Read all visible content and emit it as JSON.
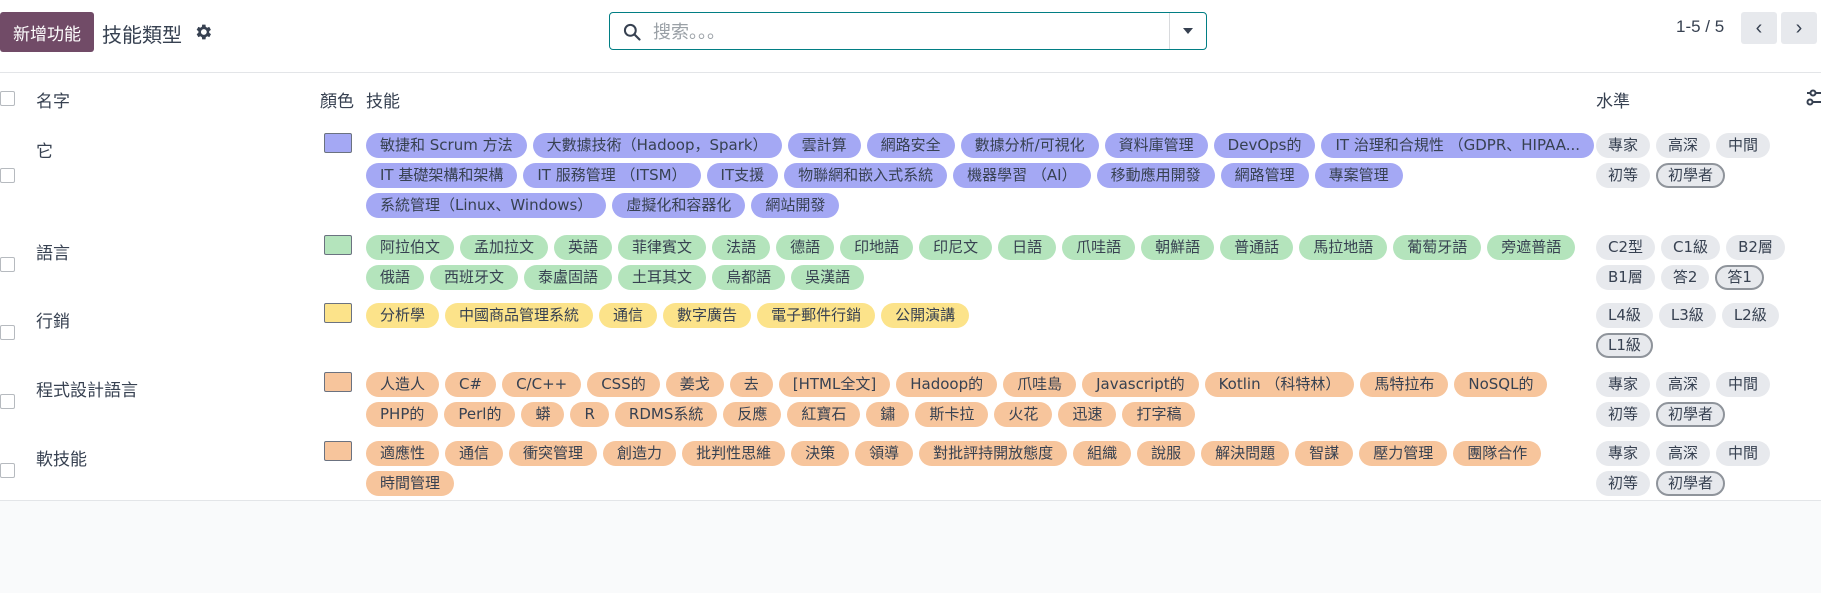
{
  "toolbar": {
    "new_label": "新增功能",
    "title": "技能類型",
    "settings_icon": "gear-icon"
  },
  "search": {
    "placeholder": "搜索。。。",
    "value": "",
    "icon": "search-icon",
    "dropdown_icon": "caret-down-icon"
  },
  "pager": {
    "value": "1-5 / 5",
    "prev_icon": "chevron-left-icon",
    "next_icon": "chevron-right-icon"
  },
  "list": {
    "headers": {
      "name": "名字",
      "color": "顏色",
      "skills": "技能",
      "levels": "水準"
    },
    "rows": [
      {
        "name": "它",
        "color": "#a4a8f4",
        "tag_color": "#a4a8f4",
        "skills": [
          "敏捷和 Scrum 方法",
          "大數據技術（Hadoop，Spark）",
          "雲計算",
          "網路安全",
          "數據分析/可視化",
          "資料庫管理",
          "DevOps的",
          "IT 治理和合規性 （GDPR、HIPAA...",
          "IT 基礎架構和架構",
          "IT 服務管理 （ITSM）",
          "IT支援",
          "物聯網和嵌入式系統",
          "機器學習 （AI）",
          "移動應用開發",
          "網路管理",
          "專案管理",
          "系統管理（Linux、Windows）",
          "虛擬化和容器化",
          "網站開發"
        ],
        "levels": [
          "專家",
          "高深",
          "中間",
          "初等",
          "初學者"
        ],
        "selected_level": "初學者"
      },
      {
        "name": "語言",
        "color": "#b4e4bc",
        "tag_color": "#b4e4bc",
        "skills": [
          "阿拉伯文",
          "孟加拉文",
          "英語",
          "菲律賓文",
          "法語",
          "德語",
          "印地語",
          "印尼文",
          "日語",
          "爪哇語",
          "朝鮮語",
          "普通話",
          "馬拉地語",
          "葡萄牙語",
          "旁遮普語",
          "俄語",
          "西班牙文",
          "泰盧固語",
          "土耳其文",
          "烏都語",
          "吳漢語"
        ],
        "levels": [
          "C2型",
          "C1級",
          "B2層",
          "B1層",
          "答2",
          "答1"
        ],
        "selected_level": "答1"
      },
      {
        "name": "行銷",
        "color": "#fce38a",
        "tag_color": "#fce38a",
        "skills": [
          "分析學",
          "中國商品管理系統",
          "通信",
          "數字廣告",
          "電子郵件行銷",
          "公開演講"
        ],
        "levels": [
          "L4級",
          "L3級",
          "L2級",
          "L1級"
        ],
        "selected_level": "L1級"
      },
      {
        "name": "程式設計語言",
        "color": "#f7c59c",
        "tag_color": "#f7c59c",
        "skills": [
          "人造人",
          "C#",
          "C/C++",
          "CSS的",
          "姜戈",
          "去",
          "[HTML全文]",
          "Hadoop的",
          "爪哇島",
          "Javascript的",
          "Kotlin （科特林）",
          "馬特拉布",
          "NoSQL的",
          "PHP的",
          "Perl的",
          "蟒",
          "R",
          "RDMS系統",
          "反應",
          "紅寶石",
          "鏽",
          "斯卡拉",
          "火花",
          "迅速",
          "打字稿"
        ],
        "levels": [
          "專家",
          "高深",
          "中間",
          "初等",
          "初學者"
        ],
        "selected_level": "初學者"
      },
      {
        "name": "軟技能",
        "color": "#f7c59c",
        "tag_color": "#f7c59c",
        "skills": [
          "適應性",
          "通信",
          "衝突管理",
          "創造力",
          "批判性思維",
          "決策",
          "領導",
          "對批評持開放態度",
          "組織",
          "說服",
          "解決問題",
          "智謀",
          "壓力管理",
          "團隊合作",
          "時間管理"
        ],
        "levels": [
          "專家",
          "高深",
          "中間",
          "初等",
          "初學者"
        ],
        "selected_level": "初學者"
      }
    ]
  }
}
